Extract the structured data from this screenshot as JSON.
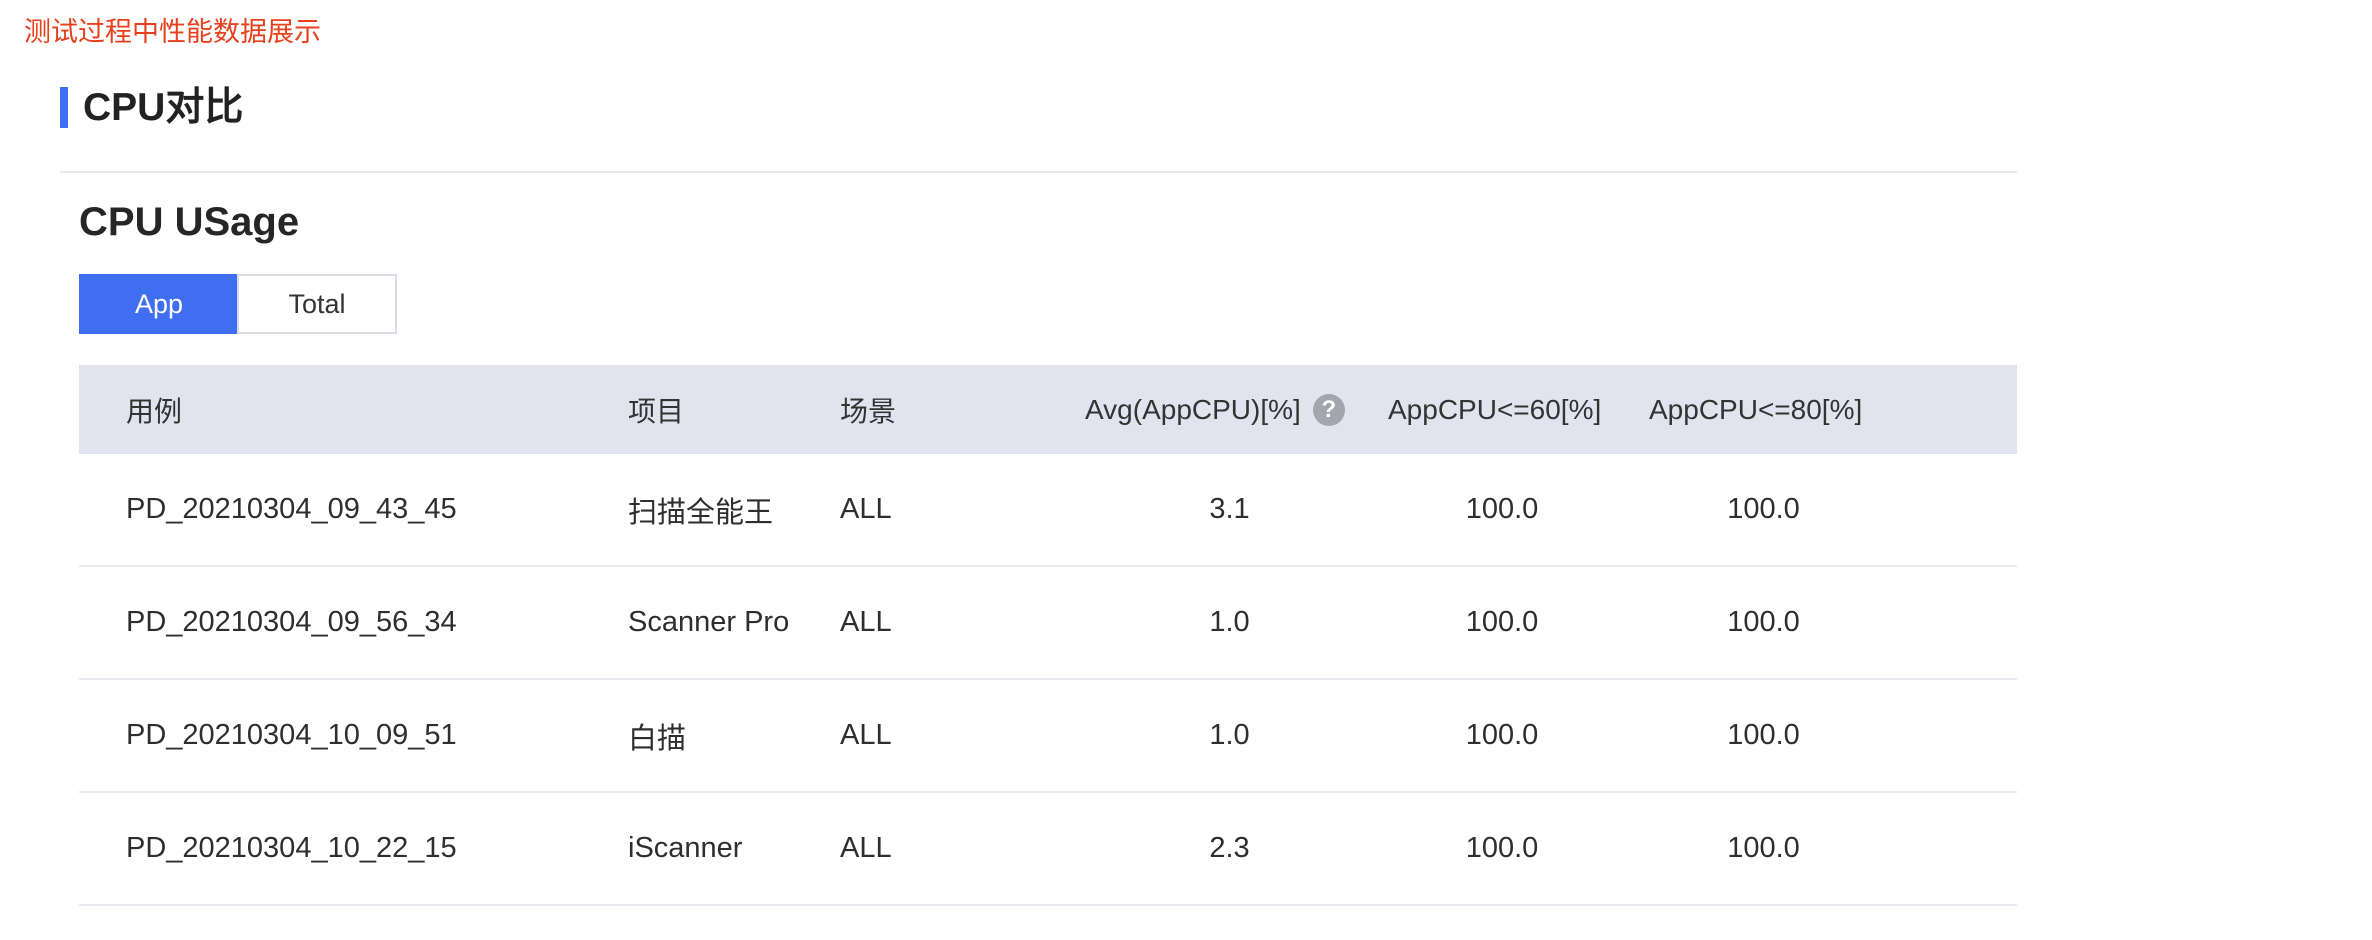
{
  "caption": "测试过程中性能数据展示",
  "section": {
    "title": "CPU对比",
    "accent_color": "#3f6ef0"
  },
  "subsection": {
    "title": "CPU USage"
  },
  "tabs": [
    {
      "label": "App",
      "active": true
    },
    {
      "label": "Total",
      "active": false
    }
  ],
  "table": {
    "headers": {
      "case": "用例",
      "project": "项目",
      "scene": "场景",
      "avg": "Avg(AppCPU)[%]",
      "le60": "AppCPU<=60[%]",
      "le80": "AppCPU<=80[%]"
    },
    "help_icon": {
      "glyph": "?",
      "icon": "question-circle-icon"
    },
    "rows": [
      {
        "case": "PD_20210304_09_43_45",
        "project": "扫描全能王",
        "scene": "ALL",
        "avg": "3.1",
        "le60": "100.0",
        "le80": "100.0"
      },
      {
        "case": "PD_20210304_09_56_34",
        "project": "Scanner Pro",
        "scene": "ALL",
        "avg": "1.0",
        "le60": "100.0",
        "le80": "100.0"
      },
      {
        "case": "PD_20210304_10_09_51",
        "project": "白描",
        "scene": "ALL",
        "avg": "1.0",
        "le60": "100.0",
        "le80": "100.0"
      },
      {
        "case": "PD_20210304_10_22_15",
        "project": "iScanner",
        "scene": "ALL",
        "avg": "2.3",
        "le60": "100.0",
        "le80": "100.0"
      }
    ]
  }
}
